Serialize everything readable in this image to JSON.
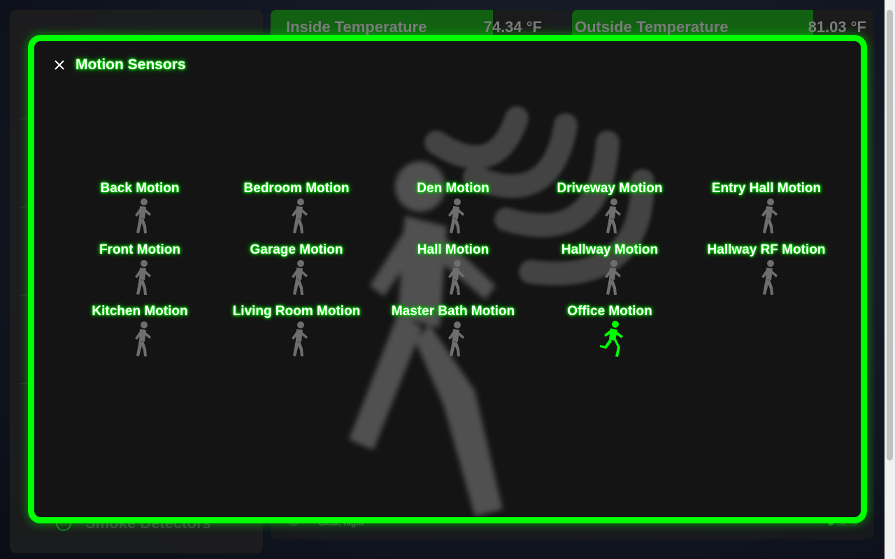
{
  "background": {
    "inside_temperature": {
      "label": "Inside Temperature",
      "value": "74.34 °F",
      "fill_fraction": 0.8
    },
    "outside_temperature": {
      "label": "Outside Temperature",
      "value": "81.03 °F",
      "fill_fraction": 0.8
    },
    "sidebar_item": {
      "label": "Smoke Detectors",
      "icon": "power-icon"
    },
    "weather": {
      "condition": "Clear, night",
      "humidity": "92 %"
    }
  },
  "modal": {
    "title": "Motion Sensors",
    "close_icon": "close-icon",
    "accent_color": "#00ff00",
    "sensors": [
      {
        "name": "Back Motion",
        "state": "clear",
        "icon": "walk-icon"
      },
      {
        "name": "Bedroom Motion",
        "state": "clear",
        "icon": "walk-icon"
      },
      {
        "name": "Den Motion",
        "state": "clear",
        "icon": "walk-icon"
      },
      {
        "name": "Driveway Motion",
        "state": "clear",
        "icon": "walk-icon"
      },
      {
        "name": "Entry Hall Motion",
        "state": "clear",
        "icon": "walk-icon"
      },
      {
        "name": "Front Motion",
        "state": "clear",
        "icon": "walk-icon"
      },
      {
        "name": "Garage Motion",
        "state": "clear",
        "icon": "walk-icon"
      },
      {
        "name": "Hall Motion",
        "state": "clear",
        "icon": "walk-icon"
      },
      {
        "name": "Hallway Motion",
        "state": "clear",
        "icon": "walk-icon"
      },
      {
        "name": "Hallway RF Motion",
        "state": "clear",
        "icon": "walk-icon"
      },
      {
        "name": "Kitchen Motion",
        "state": "clear",
        "icon": "walk-icon"
      },
      {
        "name": "Living Room Motion",
        "state": "clear",
        "icon": "walk-icon"
      },
      {
        "name": "Master Bath Motion",
        "state": "clear",
        "icon": "walk-icon"
      },
      {
        "name": "Office Motion",
        "state": "detected",
        "icon": "run-icon"
      }
    ]
  },
  "colors": {
    "idle_icon": "#6e6e6e",
    "active_icon": "#00ff00"
  }
}
